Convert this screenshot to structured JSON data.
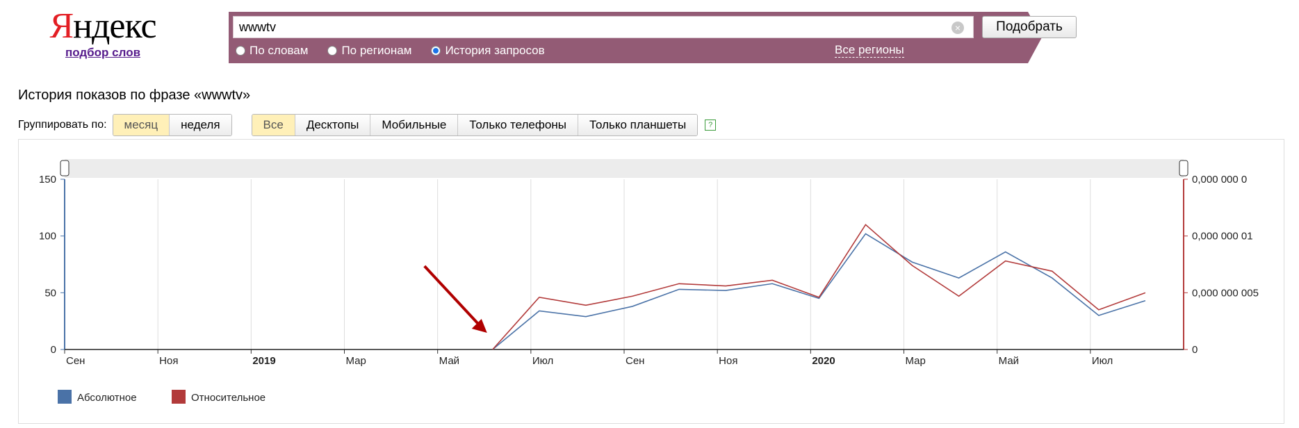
{
  "logo": {
    "text": "Яндекс",
    "first_letter": "Я",
    "rest": "ндекс",
    "subtitle": "подбор слов"
  },
  "search": {
    "value": "wwwtv",
    "button_label": "Подобрать"
  },
  "modes": [
    {
      "label": "По словам",
      "selected": false
    },
    {
      "label": "По регионам",
      "selected": false
    },
    {
      "label": "История запросов",
      "selected": true
    }
  ],
  "regions_link": "Все регионы",
  "page_title": "История показов по фразе «wwwtv»",
  "grouping": {
    "label": "Группировать по:",
    "options": [
      "месяц",
      "неделя"
    ],
    "selected": "месяц"
  },
  "devices": {
    "options": [
      "Все",
      "Десктопы",
      "Мобильные",
      "Только телефоны",
      "Только планшеты"
    ],
    "selected": "Все",
    "help": "?"
  },
  "colors": {
    "searchbar": "#935b75",
    "absolute": "#4a72a7",
    "relative": "#b23a3a",
    "arrow": "#b00000"
  },
  "chart_data": {
    "type": "line",
    "x": [
      "2018-09",
      "2018-10",
      "2018-11",
      "2018-12",
      "2019-01",
      "2019-02",
      "2019-03",
      "2019-04",
      "2019-05",
      "2019-06",
      "2019-07",
      "2019-08",
      "2019-09",
      "2019-10",
      "2019-11",
      "2019-12",
      "2020-01",
      "2020-02",
      "2020-03",
      "2020-04",
      "2020-05",
      "2020-06",
      "2020-07",
      "2020-08"
    ],
    "x_tick_labels": [
      "Сен",
      "Ноя",
      "2019",
      "Мар",
      "Май",
      "Июл",
      "Сен",
      "Ноя",
      "2020",
      "Мар",
      "Май",
      "Июл"
    ],
    "series": [
      {
        "name": "Абсолютное",
        "axis": "left",
        "color": "#4a72a7",
        "values": [
          0,
          0,
          0,
          0,
          0,
          0,
          0,
          0,
          0,
          0,
          34,
          29,
          38,
          53,
          52,
          58,
          45,
          102,
          77,
          63,
          86,
          63,
          30,
          43
        ]
      },
      {
        "name": "Относительное",
        "axis": "right",
        "color": "#b23a3a",
        "values": [
          0,
          0,
          0,
          0,
          0,
          0,
          0,
          0,
          0,
          0,
          4.6e-09,
          3.9e-09,
          4.7e-09,
          5.8e-09,
          5.6e-09,
          6.1e-09,
          4.6e-09,
          1.1e-08,
          7.4e-09,
          4.7e-09,
          7.8e-09,
          6.9e-09,
          3.5e-09,
          5e-09
        ]
      }
    ],
    "ylim": [
      0,
      150
    ],
    "y_ticks": [
      "0",
      "50",
      "100",
      "150"
    ],
    "y2lim": [
      0,
      1.5e-08
    ],
    "y2_ticks": [
      "0",
      "0,000 000 005",
      "0,000 000 01",
      "0,000 000 0"
    ],
    "legend_position": "bottom-left",
    "grid": "vertical",
    "annotation": "arrow pointing to start of data"
  }
}
